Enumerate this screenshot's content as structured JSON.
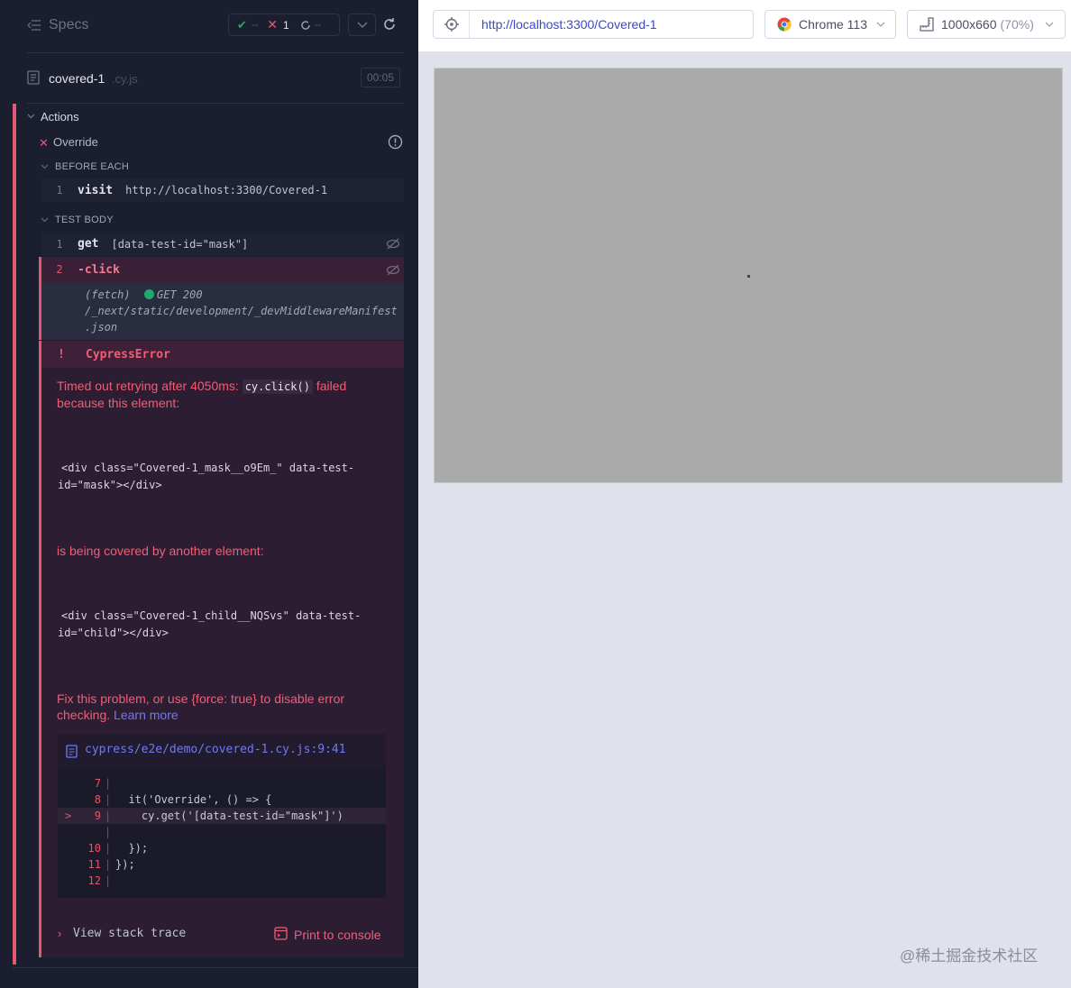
{
  "header": {
    "specs_label": "Specs",
    "passed_count": "--",
    "failed_count": "1",
    "pending_count": "--"
  },
  "spec": {
    "name": "covered-1",
    "ext": ".cy.js",
    "duration": "00:05"
  },
  "actions_label": "Actions",
  "test": {
    "title": "Override"
  },
  "before_each": {
    "label": "BEFORE EACH",
    "commands": [
      {
        "num": "1",
        "name": "visit",
        "message": "http://localhost:3300/Covered-1"
      }
    ]
  },
  "test_body": {
    "label": "TEST BODY",
    "commands": [
      {
        "num": "1",
        "name": "get",
        "message": "[data-test-id=\"mask\"]"
      },
      {
        "num": "2",
        "name": "-click",
        "message": ""
      }
    ],
    "fetch": {
      "label": "(fetch)",
      "status": "GET 200",
      "url_line1": "/_next/static/development/_devMiddlewareManifest",
      "url_line2": ".json"
    }
  },
  "error": {
    "bang": "!",
    "name": "CypressError",
    "msg_part1": "Timed out retrying after 4050ms:",
    "msg_code": "cy.click()",
    "msg_part2": "failed",
    "msg_line2": "because this element:",
    "el1_line1": "<div class=\"Covered-1_mask__o9Em_\" data-test-",
    "el1_line2": "id=\"mask\"></div>",
    "covered_text": "is being covered by another element:",
    "el2_line1": "<div class=\"Covered-1_child__NQSvs\" data-test-",
    "el2_line2": "id=\"child\"></div>",
    "fix_line1": "Fix this problem, or use {force: true} to disable error",
    "fix_line2": "checking.",
    "learn_more": "Learn more",
    "file_link": "cypress/e2e/demo/covered-1.cy.js:9:41",
    "code_lines": [
      {
        "num": "7",
        "src": "",
        "marker": ""
      },
      {
        "num": "8",
        "src": "  it('Override', () => {",
        "marker": ""
      },
      {
        "num": "9",
        "src": "    cy.get('[data-test-id=\"mask\"]')",
        "marker": ">"
      },
      {
        "num": "",
        "src": "",
        "marker": ""
      },
      {
        "num": "10",
        "src": "  });",
        "marker": ""
      },
      {
        "num": "11",
        "src": "});",
        "marker": ""
      },
      {
        "num": "12",
        "src": "",
        "marker": ""
      }
    ],
    "stack_trace_label": "View stack trace",
    "print_label": "Print to console"
  },
  "browser": {
    "url": "http://localhost:3300/Covered-1",
    "browser_name": "Chrome 113",
    "viewport_size": "1000x660",
    "viewport_scale": "(70%)"
  },
  "watermark": "@稀土掘金技术社区",
  "colors": {
    "panel_bg": "#1b1e2e",
    "error_red": "#f25d76",
    "link_blue": "#6f79f6",
    "viewport_gray": "#aaaaaa"
  }
}
